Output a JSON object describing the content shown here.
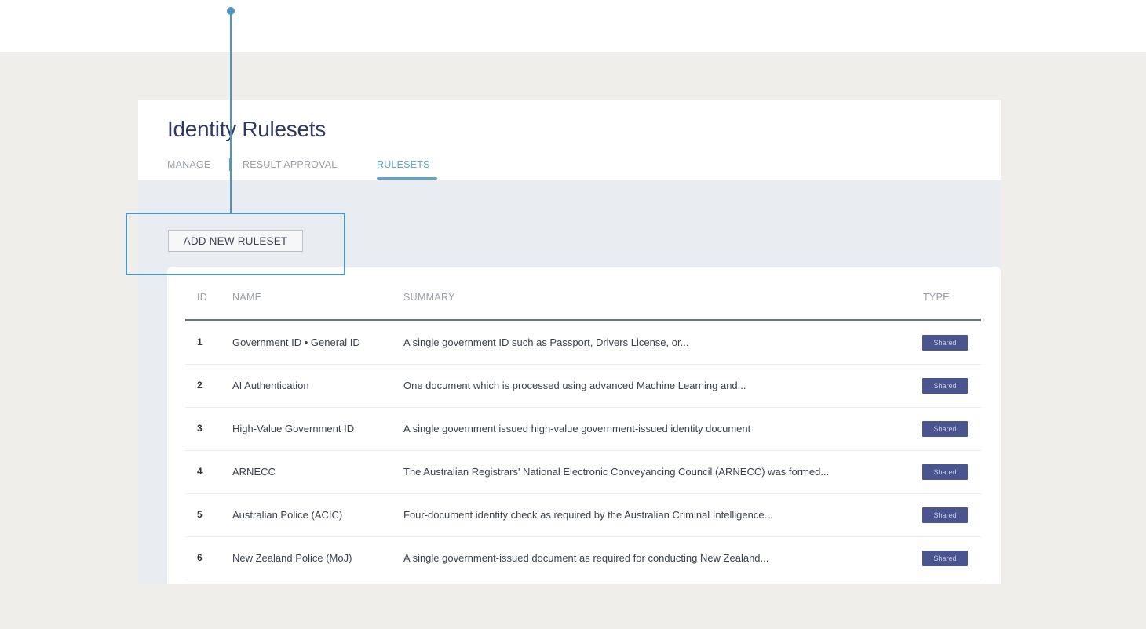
{
  "header": {
    "title": "Identity Rulesets",
    "tabs": [
      {
        "label": "MANAGE"
      },
      {
        "label": "RESULT APPROVAL"
      },
      {
        "label": "RULESETS",
        "active": true
      }
    ]
  },
  "actions": {
    "add_label": "ADD NEW RULESET"
  },
  "table": {
    "columns": {
      "id": "ID",
      "name": "NAME",
      "summary": "SUMMARY",
      "type": "TYPE"
    },
    "rows": [
      {
        "id": "1",
        "name": "Government ID • General ID",
        "summary": "A single government ID such as Passport, Drivers License, or...",
        "type": "Shared"
      },
      {
        "id": "2",
        "name": "AI Authentication",
        "summary": "One document which is processed using advanced Machine Learning and...",
        "type": "Shared"
      },
      {
        "id": "3",
        "name": "High-Value Government ID",
        "summary": "A single government issued high-value government-issued identity document",
        "type": "Shared"
      },
      {
        "id": "4",
        "name": "ARNECC",
        "summary": "The Australian Registrars' National Electronic Conveyancing Council (ARNECC) was formed...",
        "type": "Shared"
      },
      {
        "id": "5",
        "name": "Australian Police (ACIC)",
        "summary": "Four-document identity check as required by the Australian Criminal Intelligence...",
        "type": "Shared"
      },
      {
        "id": "6",
        "name": "New Zealand Police (MoJ)",
        "summary": "A single government-issued document as required for conducting New Zealand...",
        "type": "Shared"
      }
    ]
  },
  "colors": {
    "title": "#30395e",
    "active_tab": "#5ba7cc",
    "badge": "#4a5590",
    "callout": "#4f95bf"
  }
}
